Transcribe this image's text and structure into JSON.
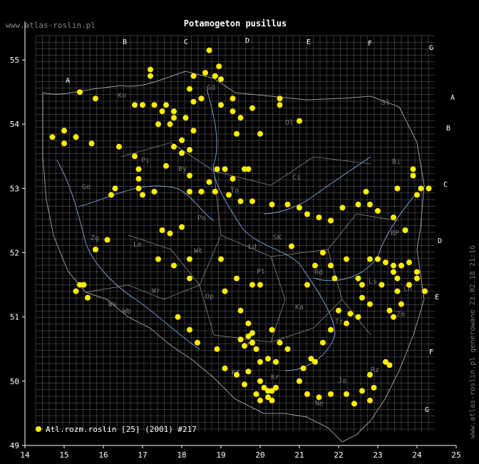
{
  "header": {
    "site": "www.atlas-roslin.pl",
    "title": "Potamogeton pusillus"
  },
  "footer": {
    "generated": "www.atlas-roslin.pl generowane 23.02.18 21:16"
  },
  "legend": {
    "label": "Atl.rozm.roslin [25] (2001) #217",
    "color": "#ffee00"
  },
  "colors": {
    "background": "#000000",
    "grid": "#bbbbbb",
    "rivers": "#7799cc",
    "borders": "#999999",
    "points": "#ffee00"
  },
  "axes": {
    "x_ticks": [
      "14",
      "15",
      "16",
      "17",
      "18",
      "19",
      "20",
      "21",
      "22",
      "23",
      "24",
      "25"
    ],
    "y_ticks": [
      "49",
      "50",
      "51",
      "52",
      "53",
      "54",
      "55"
    ],
    "x_range": [
      14,
      25
    ],
    "y_range": [
      49,
      55.6
    ]
  },
  "grid_letters": {
    "top": [
      "A",
      "B",
      "C",
      "D",
      "E",
      "F",
      "G"
    ],
    "right": [
      "A",
      "B",
      "C",
      "D",
      "E",
      "F",
      "G"
    ]
  },
  "region_labels": [
    "Ko",
    "Gd",
    "Sł",
    "Ol",
    "Bi",
    "Pi",
    "By",
    "To",
    "Ci",
    "Go",
    "Po",
    "Wł",
    "SK",
    "Łd",
    "Zg",
    "Le",
    "Ka",
    "Pt",
    "Rd",
    "Ls",
    "BP",
    "Ch",
    "Wr",
    "Op",
    "Zm",
    "Kc",
    "Kr",
    "Ne",
    "Tr",
    "Ws",
    "Ja",
    "Rz",
    "Wb",
    "Kt"
  ],
  "map": {
    "type": "distribution-map",
    "marker": "filled-circle",
    "points": [
      [
        18.7,
        55.15
      ],
      [
        18.95,
        54.9
      ],
      [
        18.6,
        54.8
      ],
      [
        18.85,
        54.75
      ],
      [
        19.0,
        54.7
      ],
      [
        18.3,
        54.75
      ],
      [
        18.2,
        54.55
      ],
      [
        18.5,
        54.4
      ],
      [
        18.3,
        54.35
      ],
      [
        18.1,
        54.1
      ],
      [
        17.2,
        54.85
      ],
      [
        17.2,
        54.75
      ],
      [
        16.8,
        54.3
      ],
      [
        17.0,
        54.3
      ],
      [
        17.3,
        54.3
      ],
      [
        17.6,
        54.3
      ],
      [
        17.8,
        54.2
      ],
      [
        17.8,
        54.1
      ],
      [
        17.7,
        54.0
      ],
      [
        17.4,
        54.0
      ],
      [
        17.5,
        54.2
      ],
      [
        15.4,
        54.5
      ],
      [
        15.8,
        54.4
      ],
      [
        15.0,
        53.9
      ],
      [
        15.3,
        53.8
      ],
      [
        14.7,
        53.8
      ],
      [
        15.0,
        53.7
      ],
      [
        15.7,
        53.7
      ],
      [
        16.4,
        53.65
      ],
      [
        16.8,
        53.5
      ],
      [
        16.9,
        53.3
      ],
      [
        16.9,
        53.15
      ],
      [
        16.9,
        53.0
      ],
      [
        16.2,
        52.9
      ],
      [
        16.3,
        53.0
      ],
      [
        17.0,
        52.9
      ],
      [
        17.3,
        52.95
      ],
      [
        17.6,
        53.35
      ],
      [
        17.8,
        53.65
      ],
      [
        18.2,
        53.2
      ],
      [
        19.0,
        54.3
      ],
      [
        19.3,
        54.4
      ],
      [
        19.3,
        54.2
      ],
      [
        19.5,
        54.1
      ],
      [
        19.8,
        54.25
      ],
      [
        20.5,
        54.3
      ],
      [
        20.5,
        54.4
      ],
      [
        21.0,
        54.05
      ],
      [
        19.4,
        53.85
      ],
      [
        20.0,
        53.85
      ],
      [
        18.0,
        53.55
      ],
      [
        18.2,
        53.6
      ],
      [
        18.0,
        53.75
      ],
      [
        18.3,
        53.9
      ],
      [
        18.9,
        53.3
      ],
      [
        19.1,
        53.3
      ],
      [
        19.3,
        53.15
      ],
      [
        19.6,
        53.3
      ],
      [
        19.7,
        53.3
      ],
      [
        18.7,
        53.1
      ],
      [
        18.2,
        52.95
      ],
      [
        18.5,
        52.95
      ],
      [
        18.85,
        52.95
      ],
      [
        19.2,
        52.9
      ],
      [
        19.5,
        52.8
      ],
      [
        19.8,
        52.8
      ],
      [
        20.3,
        52.75
      ],
      [
        20.7,
        52.75
      ],
      [
        21.0,
        52.7
      ],
      [
        21.5,
        52.55
      ],
      [
        21.8,
        52.5
      ],
      [
        22.1,
        52.7
      ],
      [
        22.5,
        52.75
      ],
      [
        22.8,
        52.75
      ],
      [
        23.0,
        52.65
      ],
      [
        23.4,
        52.55
      ],
      [
        23.7,
        52.35
      ],
      [
        24.0,
        52.9
      ],
      [
        24.1,
        53.0
      ],
      [
        23.9,
        53.2
      ],
      [
        23.9,
        53.3
      ],
      [
        23.5,
        53.0
      ],
      [
        22.7,
        52.95
      ],
      [
        24.3,
        53.0
      ],
      [
        17.5,
        52.35
      ],
      [
        17.7,
        52.3
      ],
      [
        18.0,
        52.4
      ],
      [
        16.1,
        52.2
      ],
      [
        15.8,
        52.05
      ],
      [
        17.4,
        51.9
      ],
      [
        17.8,
        51.8
      ],
      [
        18.2,
        51.9
      ],
      [
        18.2,
        51.6
      ],
      [
        19.0,
        51.9
      ],
      [
        19.4,
        51.6
      ],
      [
        19.8,
        51.5
      ],
      [
        20.0,
        51.5
      ],
      [
        21.2,
        52.6
      ],
      [
        22.2,
        51.9
      ],
      [
        22.8,
        51.9
      ],
      [
        23.0,
        51.9
      ],
      [
        23.2,
        51.85
      ],
      [
        23.4,
        51.8
      ],
      [
        23.6,
        51.8
      ],
      [
        23.8,
        51.85
      ],
      [
        24.0,
        51.7
      ],
      [
        23.4,
        51.7
      ],
      [
        23.5,
        51.6
      ],
      [
        23.8,
        51.5
      ],
      [
        23.1,
        51.5
      ],
      [
        22.6,
        51.5
      ],
      [
        22.5,
        51.6
      ],
      [
        22.6,
        51.3
      ],
      [
        22.8,
        51.2
      ],
      [
        23.3,
        51.1
      ],
      [
        23.4,
        51.0
      ],
      [
        23.6,
        51.2
      ],
      [
        23.5,
        51.4
      ],
      [
        24.2,
        51.4
      ],
      [
        24.0,
        51.6
      ],
      [
        21.4,
        51.8
      ],
      [
        21.8,
        51.8
      ],
      [
        21.6,
        52.0
      ],
      [
        21.9,
        51.6
      ],
      [
        15.5,
        51.5
      ],
      [
        15.6,
        51.3
      ],
      [
        15.3,
        51.4
      ],
      [
        15.4,
        51.5
      ],
      [
        17.9,
        51.0
      ],
      [
        18.2,
        50.8
      ],
      [
        18.4,
        50.6
      ],
      [
        18.9,
        50.5
      ],
      [
        19.1,
        51.4
      ],
      [
        19.5,
        51.1
      ],
      [
        19.7,
        50.9
      ],
      [
        19.7,
        50.7
      ],
      [
        19.8,
        50.6
      ],
      [
        19.6,
        50.55
      ],
      [
        19.9,
        50.5
      ],
      [
        20.0,
        50.3
      ],
      [
        20.2,
        50.35
      ],
      [
        20.4,
        50.3
      ],
      [
        20.5,
        50.6
      ],
      [
        20.7,
        50.5
      ],
      [
        21.2,
        51.5
      ],
      [
        22.0,
        51.1
      ],
      [
        22.3,
        51.05
      ],
      [
        22.5,
        51.0
      ],
      [
        22.2,
        50.9
      ],
      [
        21.8,
        50.8
      ],
      [
        21.6,
        50.6
      ],
      [
        21.4,
        50.3
      ],
      [
        21.3,
        50.35
      ],
      [
        21.1,
        50.2
      ],
      [
        20.0,
        50.0
      ],
      [
        20.1,
        49.9
      ],
      [
        20.2,
        49.85
      ],
      [
        20.3,
        49.85
      ],
      [
        20.4,
        49.9
      ],
      [
        19.9,
        49.8
      ],
      [
        20.0,
        49.7
      ],
      [
        20.2,
        49.75
      ],
      [
        20.3,
        49.7
      ],
      [
        19.6,
        49.95
      ],
      [
        19.1,
        50.2
      ],
      [
        19.4,
        50.1
      ],
      [
        19.7,
        50.15
      ],
      [
        21.0,
        50.0
      ],
      [
        21.2,
        49.8
      ],
      [
        21.5,
        49.75
      ],
      [
        21.8,
        49.8
      ],
      [
        22.2,
        49.8
      ],
      [
        22.6,
        49.85
      ],
      [
        22.9,
        49.9
      ],
      [
        22.8,
        49.7
      ],
      [
        22.4,
        49.65
      ],
      [
        22.8,
        50.1
      ],
      [
        23.2,
        50.3
      ],
      [
        23.3,
        50.25
      ],
      [
        20.8,
        52.1
      ],
      [
        20.3,
        50.8
      ],
      [
        19.8,
        50.75
      ],
      [
        19.5,
        50.65
      ]
    ]
  }
}
